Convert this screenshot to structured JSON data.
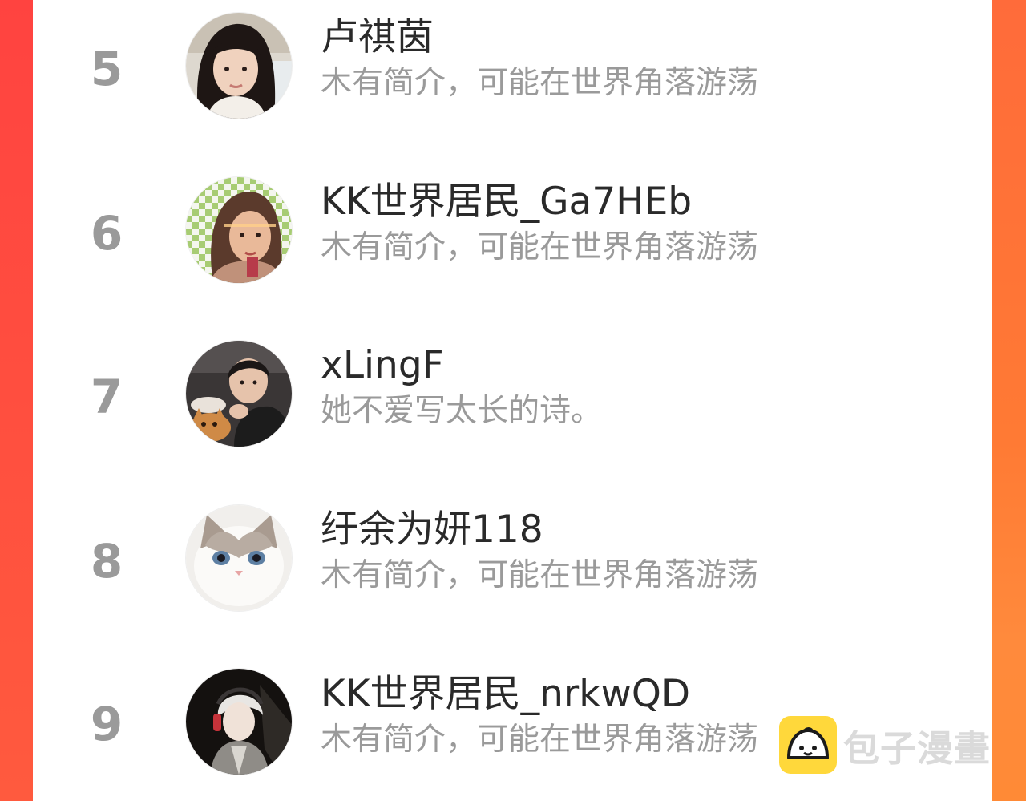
{
  "users": [
    {
      "rank": "5",
      "name": "卢祺茵",
      "bio": "木有简介，可能在世界角落游荡",
      "avatar_icon": "avatar-photo-woman-long-hair"
    },
    {
      "rank": "6",
      "name": "KK世界居民_Ga7HEb",
      "bio": "木有简介，可能在世界角落游荡",
      "avatar_icon": "avatar-photo-woman-checkered-background"
    },
    {
      "rank": "7",
      "name": "xLingF",
      "bio": "她不爱写太长的诗。",
      "avatar_icon": "avatar-photo-man-with-cat"
    },
    {
      "rank": "8",
      "name": "纡余为妍118",
      "bio": "木有简介，可能在世界角落游荡",
      "avatar_icon": "avatar-photo-ragdoll-cat"
    },
    {
      "rank": "9",
      "name": "KK世界居民_nrkwQD",
      "bio": "木有简介，可能在世界角落游荡",
      "avatar_icon": "avatar-illustration-anime-boy"
    }
  ],
  "watermark": {
    "text": "包子漫畫",
    "logo_icon": "baozi-bun-logo-icon"
  },
  "colors": {
    "background_left": "#ff4a40",
    "background_right": "#ff7f37",
    "panel": "#ffffff",
    "rank_text": "#9a9a9a",
    "name_text": "#2a2a2a",
    "bio_text": "#9a9a9a",
    "watermark_logo": "#ffd83b"
  }
}
